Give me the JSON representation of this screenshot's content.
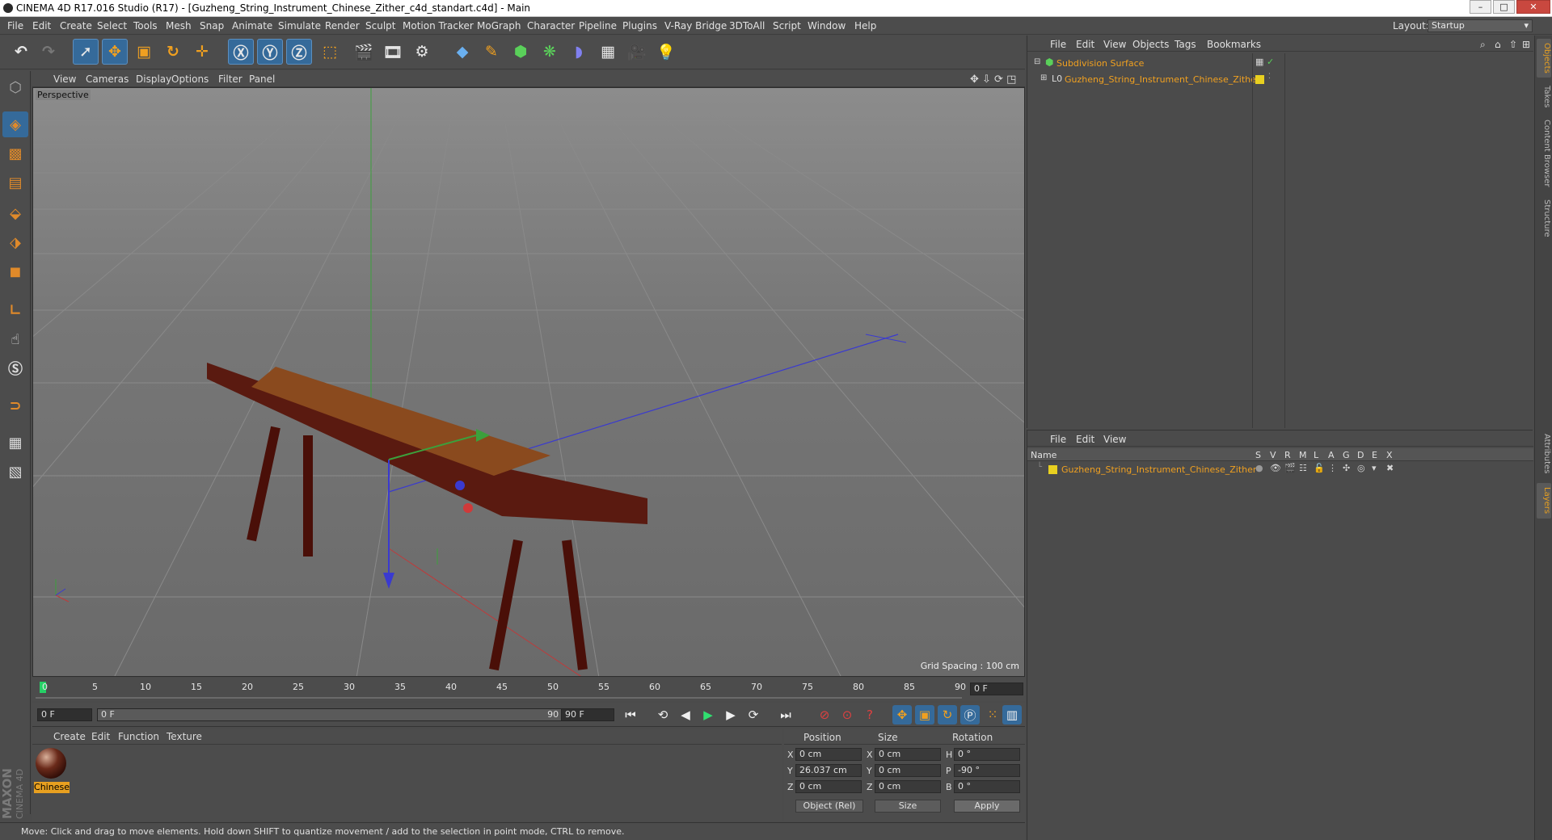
{
  "window": {
    "title": "CINEMA 4D R17.016 Studio (R17) - [Guzheng_String_Instrument_Chinese_Zither_c4d_standart.c4d] - Main"
  },
  "menus": [
    "File",
    "Edit",
    "Create",
    "Select",
    "Tools",
    "Mesh",
    "Snap",
    "Animate",
    "Simulate",
    "Render",
    "Sculpt",
    "Motion Tracker",
    "MoGraph",
    "Character",
    "Pipeline",
    "Plugins",
    "V-Ray Bridge",
    "3DToAll",
    "Script",
    "Window",
    "Help"
  ],
  "layout": {
    "label": "Layout:",
    "value": "Startup"
  },
  "viewport": {
    "menu": [
      "View",
      "Cameras",
      "Display",
      "Options",
      "Filter",
      "Panel"
    ],
    "label": "Perspective",
    "grid_spacing": "Grid Spacing : 100 cm",
    "object_color": "#5a1a10"
  },
  "timeline": {
    "ticks": [
      "0",
      "5",
      "10",
      "15",
      "20",
      "25",
      "30",
      "35",
      "40",
      "45",
      "50",
      "55",
      "60",
      "65",
      "70",
      "75",
      "80",
      "85",
      "90"
    ],
    "current_frame": "0 F",
    "start_field": "0 F",
    "range_start": "0 F",
    "range_end": "90 F",
    "end_field": "90 F"
  },
  "material_manager": {
    "menu": [
      "Create",
      "Edit",
      "Function",
      "Texture"
    ],
    "material_label": "Chinese"
  },
  "maxon": {
    "line1": "MAXON",
    "line2": "CINEMA 4D"
  },
  "coordinates": {
    "headers": {
      "position": "Position",
      "size": "Size",
      "rotation": "Rotation"
    },
    "rows": [
      {
        "axis": "X",
        "pos": "0 cm",
        "axis2": "X",
        "size": "0 cm",
        "axis3": "H",
        "rot": "0 °"
      },
      {
        "axis": "Y",
        "pos": "26.037 cm",
        "axis2": "Y",
        "size": "0 cm",
        "axis3": "P",
        "rot": "-90 °"
      },
      {
        "axis": "Z",
        "pos": "0 cm",
        "axis2": "Z",
        "size": "0 cm",
        "axis3": "B",
        "rot": "0 °"
      }
    ],
    "mode": "Object (Rel)",
    "size_mode": "Size",
    "apply": "Apply"
  },
  "status": "Move: Click and drag to move elements. Hold down SHIFT to quantize movement / add to the selection in point mode, CTRL to remove.",
  "object_manager": {
    "menu": [
      "File",
      "Edit",
      "View",
      "Objects",
      "Tags",
      "Bookmarks"
    ],
    "objects": [
      {
        "name": "Subdivision Surface"
      },
      {
        "name": "Guzheng_String_Instrument_Chinese_Zither"
      }
    ]
  },
  "layer_manager": {
    "menu": [
      "File",
      "Edit",
      "View"
    ],
    "columns": [
      "Name",
      "S",
      "V",
      "R",
      "M",
      "L",
      "A",
      "G",
      "D",
      "E",
      "X"
    ],
    "layers": [
      {
        "name": "Guzheng_String_Instrument_Chinese_Zither"
      }
    ],
    "layer_color": "#e8d020"
  },
  "side_tabs": [
    "Objects",
    "Takes",
    "Content Browser",
    "Structure",
    "Attributes",
    "Layers"
  ]
}
